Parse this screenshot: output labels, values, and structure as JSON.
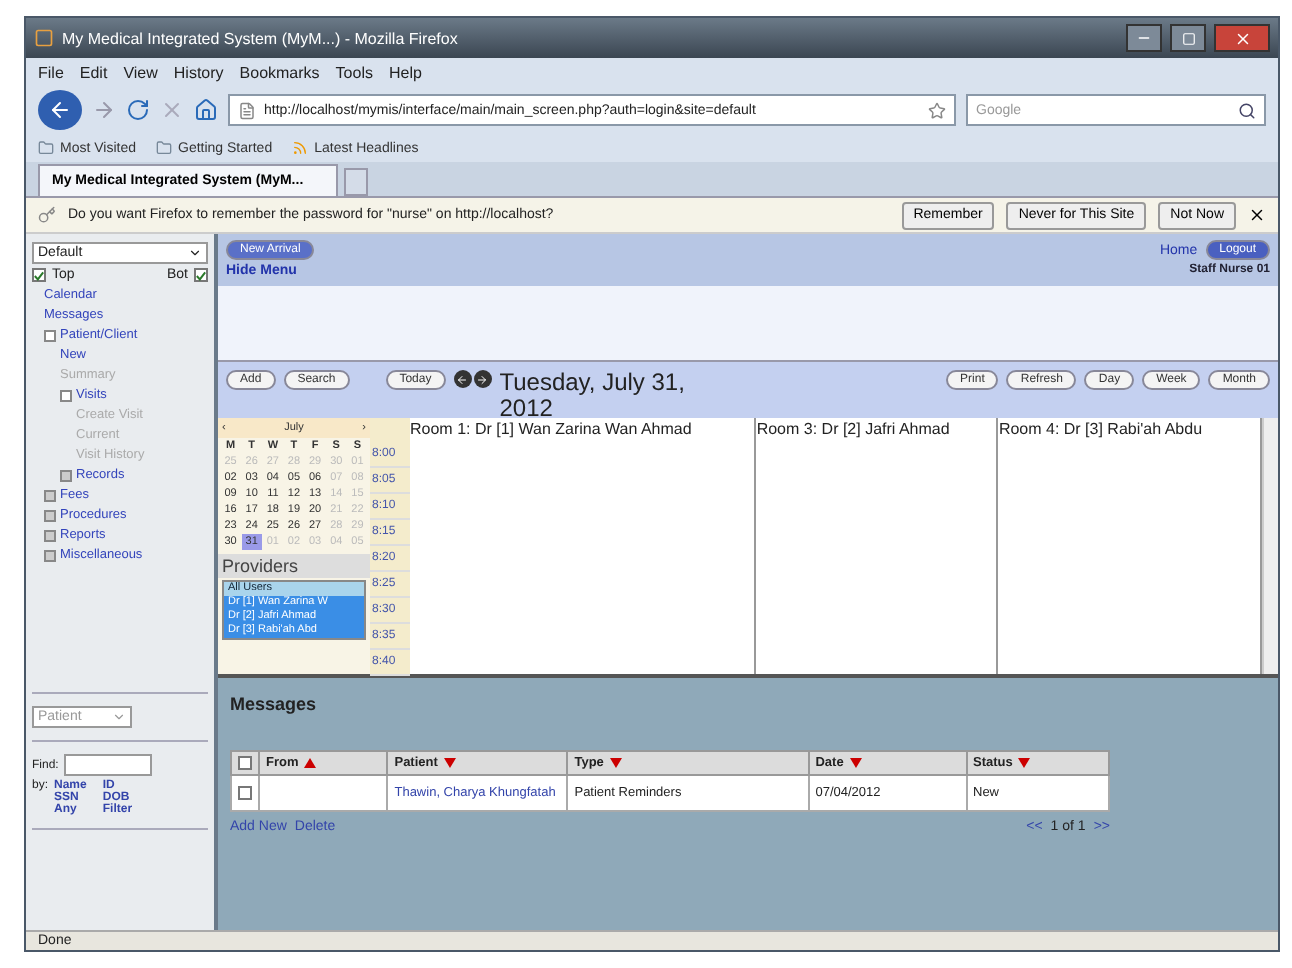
{
  "window": {
    "title": "My Medical Integrated System (MyM...) - Mozilla Firefox"
  },
  "menu": [
    "File",
    "Edit",
    "View",
    "History",
    "Bookmarks",
    "Tools",
    "Help"
  ],
  "address": {
    "url": "http://localhost/mymis/interface/main/main_screen.php?auth=login&site=default"
  },
  "search": {
    "placeholder": "Google"
  },
  "bookmarks": [
    "Most Visited",
    "Getting Started",
    "Latest Headlines"
  ],
  "tabs": [
    {
      "label": "My Medical Integrated System (MyM...",
      "selected": true
    }
  ],
  "notification": {
    "text": "Do you want Firefox to remember the password for \"nurse\" on http://localhost?",
    "buttons": [
      "Remember",
      "Never for This Site",
      "Not Now"
    ]
  },
  "sidebar": {
    "layout_select": "Default",
    "top": {
      "label": "Top",
      "checked": true
    },
    "bot": {
      "label": "Bot",
      "checked": true
    },
    "tree": [
      {
        "label": "Calendar",
        "disabled": false
      },
      {
        "label": "Messages",
        "disabled": false
      },
      {
        "label": "Patient/Client",
        "disabled": false,
        "expanded": true,
        "children": [
          {
            "label": "New",
            "disabled": false
          },
          {
            "label": "Summary",
            "disabled": true
          },
          {
            "label": "Visits",
            "disabled": false,
            "expanded": true,
            "children": [
              {
                "label": "Create Visit",
                "disabled": true
              },
              {
                "label": "Current",
                "disabled": true
              },
              {
                "label": "Visit History",
                "disabled": true
              }
            ]
          },
          {
            "label": "Records",
            "disabled": false,
            "expanded": false
          }
        ]
      },
      {
        "label": "Fees",
        "disabled": false,
        "expanded": false
      },
      {
        "label": "Procedures",
        "disabled": false,
        "expanded": false
      },
      {
        "label": "Reports",
        "disabled": false,
        "expanded": false
      },
      {
        "label": "Miscellaneous",
        "disabled": false,
        "expanded": false
      }
    ],
    "find_select": "Patient",
    "find_label": "Find:",
    "by_label": "by:",
    "find_links": [
      "Name",
      "ID",
      "SSN",
      "DOB",
      "Any",
      "Filter"
    ]
  },
  "header": {
    "button": "New Arrival",
    "hide_menu": "Hide Menu",
    "home": "Home",
    "logout": "Logout",
    "user": "Staff Nurse 01"
  },
  "toolbar": {
    "left": [
      "Add",
      "Search"
    ],
    "today": "Today",
    "date": "Tuesday, July 31, 2012",
    "right": [
      "Print",
      "Refresh",
      "Day",
      "Week",
      "Month"
    ]
  },
  "mini_calendar": {
    "month": "July",
    "prev": "‹",
    "next": "›",
    "weekdays": [
      "M",
      "T",
      "W",
      "T",
      "F",
      "S",
      "S"
    ],
    "weeks": [
      [
        {
          "d": "25",
          "muted": true,
          "selected": false
        },
        {
          "d": "26",
          "muted": true,
          "selected": false
        },
        {
          "d": "27",
          "muted": true,
          "selected": false
        },
        {
          "d": "28",
          "muted": true,
          "selected": false
        },
        {
          "d": "29",
          "muted": true,
          "selected": false
        },
        {
          "d": "30",
          "muted": true,
          "selected": false
        },
        {
          "d": "01",
          "muted": true,
          "selected": false
        }
      ],
      [
        {
          "d": "02",
          "muted": false,
          "selected": false
        },
        {
          "d": "03",
          "muted": false,
          "selected": false
        },
        {
          "d": "04",
          "muted": false,
          "selected": false
        },
        {
          "d": "05",
          "muted": false,
          "selected": false
        },
        {
          "d": "06",
          "muted": false,
          "selected": false
        },
        {
          "d": "07",
          "muted": true,
          "selected": false
        },
        {
          "d": "08",
          "muted": true,
          "selected": false
        }
      ],
      [
        {
          "d": "09",
          "muted": false,
          "selected": false
        },
        {
          "d": "10",
          "muted": false,
          "selected": false
        },
        {
          "d": "11",
          "muted": false,
          "selected": false
        },
        {
          "d": "12",
          "muted": false,
          "selected": false
        },
        {
          "d": "13",
          "muted": false,
          "selected": false
        },
        {
          "d": "14",
          "muted": true,
          "selected": false
        },
        {
          "d": "15",
          "muted": true,
          "selected": false
        }
      ],
      [
        {
          "d": "16",
          "muted": false,
          "selected": false
        },
        {
          "d": "17",
          "muted": false,
          "selected": false
        },
        {
          "d": "18",
          "muted": false,
          "selected": false
        },
        {
          "d": "19",
          "muted": false,
          "selected": false
        },
        {
          "d": "20",
          "muted": false,
          "selected": false
        },
        {
          "d": "21",
          "muted": true,
          "selected": false
        },
        {
          "d": "22",
          "muted": true,
          "selected": false
        }
      ],
      [
        {
          "d": "23",
          "muted": false,
          "selected": false
        },
        {
          "d": "24",
          "muted": false,
          "selected": false
        },
        {
          "d": "25",
          "muted": false,
          "selected": false
        },
        {
          "d": "26",
          "muted": false,
          "selected": false
        },
        {
          "d": "27",
          "muted": false,
          "selected": false
        },
        {
          "d": "28",
          "muted": true,
          "selected": false
        },
        {
          "d": "29",
          "muted": true,
          "selected": false
        }
      ],
      [
        {
          "d": "30",
          "muted": false,
          "selected": false
        },
        {
          "d": "31",
          "muted": false,
          "selected": true
        },
        {
          "d": "01",
          "muted": true,
          "selected": false
        },
        {
          "d": "02",
          "muted": true,
          "selected": false
        },
        {
          "d": "03",
          "muted": true,
          "selected": false
        },
        {
          "d": "04",
          "muted": true,
          "selected": false
        },
        {
          "d": "05",
          "muted": true,
          "selected": false
        }
      ]
    ]
  },
  "providers": {
    "title": "Providers",
    "items": [
      {
        "label": "All Users",
        "selected": false
      },
      {
        "label": "Dr [1] Wan Zarina W",
        "selected": true
      },
      {
        "label": "Dr [2] Jafri Ahmad",
        "selected": true
      },
      {
        "label": "Dr [3] Rabi'ah Abd",
        "selected": true
      }
    ]
  },
  "schedule": {
    "times": [
      "8:00",
      "8:05",
      "8:10",
      "8:15",
      "8:20",
      "8:25",
      "8:30",
      "8:35",
      "8:40"
    ],
    "rooms": [
      "Room 1: Dr [1] Wan Zarina Wan Ahmad",
      "Room 3: Dr [2] Jafri Ahmad",
      "Room 4: Dr [3] Rabi'ah Abdu"
    ]
  },
  "messages": {
    "title": "Messages",
    "select_all": {
      "checked": false
    },
    "columns": [
      {
        "label": "From",
        "descending": false
      },
      {
        "label": "Patient",
        "descending": true
      },
      {
        "label": "Type",
        "descending": true
      },
      {
        "label": "Date",
        "descending": true
      },
      {
        "label": "Status",
        "descending": true
      }
    ],
    "rows": [
      {
        "checked": false,
        "from": "",
        "patient": "Thawin, Charya Khungfatah",
        "type": "Patient Reminders",
        "date": "07/04/2012",
        "status": "New"
      }
    ],
    "actions": [
      "Add New",
      "Delete"
    ],
    "pager": {
      "prev": "<<",
      "page": "1 of 1",
      "next": ">>"
    }
  },
  "status_bar": "Done"
}
